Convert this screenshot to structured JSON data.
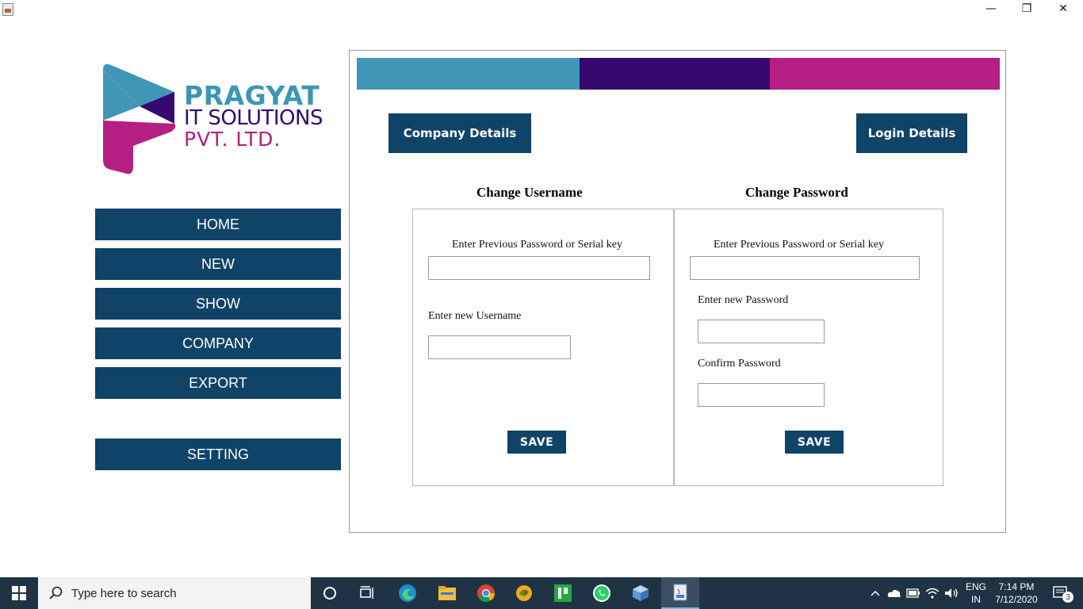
{
  "window": {
    "minimize": "—",
    "restore": "❐",
    "close": "✕"
  },
  "logo": {
    "line1": "PRAGYAT",
    "line2": "IT SOLUTIONS",
    "line3": "PVT. LTD."
  },
  "colors": {
    "accent_teal": "#4096b7",
    "accent_purple": "#36096e",
    "accent_magenta": "#b51e82",
    "nav_blue": "#0f4368"
  },
  "sidebar": {
    "items": [
      {
        "label": "HOME"
      },
      {
        "label": "NEW"
      },
      {
        "label": "SHOW"
      },
      {
        "label": "COMPANY"
      },
      {
        "label": "EXPORT"
      },
      {
        "label": "SETTING"
      }
    ]
  },
  "tabs": {
    "company": "Company Details",
    "login": "Login Details"
  },
  "username_form": {
    "title": "Change Username",
    "prev_label": "Enter Previous Password or Serial key",
    "prev_value": "",
    "new_label": "Enter new Username",
    "new_value": "",
    "save": "SAVE"
  },
  "password_form": {
    "title": "Change Password",
    "prev_label": "Enter Previous Password or Serial key",
    "prev_value": "",
    "new_label": "Enter new Password",
    "new_value": "",
    "confirm_label": "Confirm Password",
    "confirm_value": "",
    "save": "SAVE"
  },
  "taskbar": {
    "search_placeholder": "Type here to search",
    "icons": [
      "cortana-icon",
      "task-view-icon",
      "edge-icon",
      "file-explorer-icon",
      "chrome-icon",
      "app-icon",
      "green-app-icon",
      "whatsapp-icon",
      "box-app-icon",
      "java-icon"
    ],
    "lang_top": "ENG",
    "lang_bottom": "IN",
    "time": "7:14 PM",
    "date": "7/12/2020",
    "notifications": "3"
  }
}
